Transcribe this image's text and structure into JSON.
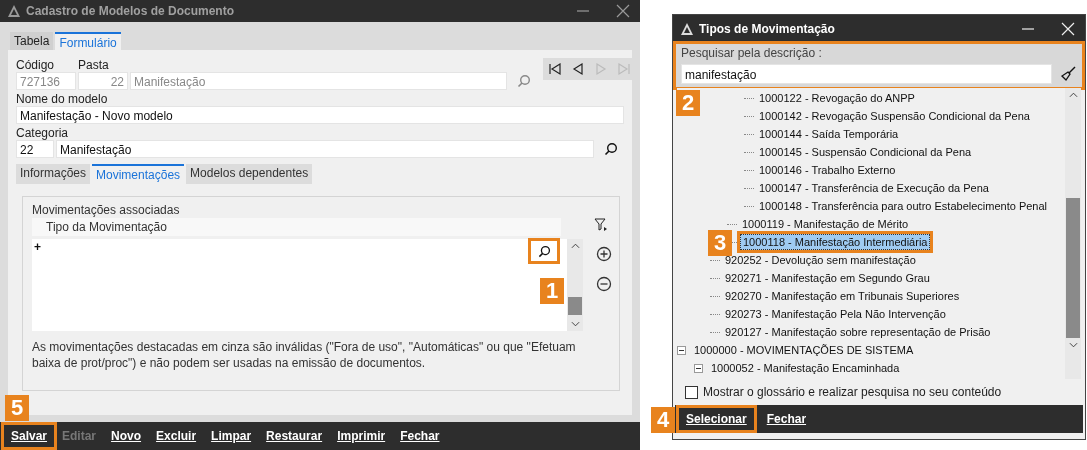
{
  "left_window": {
    "title": "Cadastro de Modelos de Documento",
    "tabs": [
      {
        "label": "Tabela",
        "selected": false
      },
      {
        "label": "Formulário",
        "selected": true
      }
    ],
    "codigo": {
      "label": "Código",
      "value": "727136",
      "disabled": true
    },
    "pasta": {
      "label": "Pasta",
      "number": "22",
      "name": "Manifestação",
      "disabled": true
    },
    "nome": {
      "label": "Nome do modelo",
      "value": "Manifestação - Novo modelo"
    },
    "categoria": {
      "label": "Categoria",
      "number": "22",
      "name": "Manifestação"
    },
    "nav_buttons": [
      {
        "kind": "first",
        "disabled": false
      },
      {
        "kind": "prev",
        "disabled": false
      },
      {
        "kind": "next",
        "disabled": true
      },
      {
        "kind": "last",
        "disabled": true
      }
    ],
    "subtabs": [
      {
        "label": "Informações",
        "selected": false
      },
      {
        "label": "Movimentações",
        "selected": true
      },
      {
        "label": "Modelos dependentes",
        "selected": false
      }
    ],
    "group": {
      "title": "Movimentações associadas",
      "column": "Tipo da Movimentação",
      "row_marker": "+",
      "note": "As movimentações destacadas em cinza são inválidas (\"Fora de uso\", \"Automáticas\" ou que \"Efetuam baixa de prot/proc\") e não podem ser usadas na emissão de documentos."
    },
    "toolbar": [
      {
        "label": "Salvar",
        "disabled": false
      },
      {
        "label": "Editar",
        "disabled": true
      },
      {
        "label": "Novo",
        "disabled": false
      },
      {
        "label": "Excluir",
        "disabled": false
      },
      {
        "label": "Limpar",
        "disabled": false
      },
      {
        "label": "Restaurar",
        "disabled": false
      },
      {
        "label": "Imprimir",
        "disabled": false
      },
      {
        "label": "Fechar",
        "disabled": false
      }
    ]
  },
  "right_window": {
    "title": "Tipos de Movimentação",
    "search": {
      "label": "Pesquisar pela descrição :",
      "value": "manifestação"
    },
    "tree": [
      {
        "children": [
          {
            "children": [
              {
                "children": [
                  {
                    "label": "1000122 - Revogação do ANPP",
                    "selected": false
                  },
                  {
                    "label": "1000142 - Revogação Suspensão Condicional da Pena",
                    "selected": false
                  },
                  {
                    "label": "1000144 - Saída Temporária",
                    "selected": false
                  },
                  {
                    "label": "1000145 - Suspensão Condicional da Pena",
                    "selected": false
                  },
                  {
                    "label": "1000146 - Trabalho Externo",
                    "selected": false
                  },
                  {
                    "label": "1000147 - Transferência de Execução da Pena",
                    "selected": false
                  },
                  {
                    "label": "1000148 - Transferência para outro Estabelecimento Penal",
                    "selected": false
                  }
                ]
              },
              {
                "label": "1000119 - Manifestação de Mérito",
                "selected": false
              },
              {
                "label": "1000118 - Manifestação Intermediária",
                "selected": true
              }
            ]
          },
          {
            "label": "920252 - Devolução sem manifestação",
            "selected": false
          },
          {
            "label": "920271 - Manifestação em Segundo Grau",
            "selected": false
          },
          {
            "label": "920270 - Manifestação  em Tribunais Superiores",
            "selected": false
          },
          {
            "label": "920273 - Manifestação Pela Não Intervenção",
            "selected": false
          },
          {
            "label": "920127 - Manifestação sobre representação de Prisão",
            "selected": false
          }
        ]
      },
      {
        "label": "1000000 - MOVIMENTAÇÕES DE SISTEMA",
        "selected": false,
        "expanded": true,
        "children": [
          {
            "label": "1000052 - Manifestação Encaminhada",
            "selected": false,
            "expanded": true
          }
        ]
      }
    ],
    "glossary": {
      "label": "Mostrar o glossário e realizar pesquisa no seu conteúdo",
      "checked": false
    },
    "buttons": [
      {
        "label": "Selecionar"
      },
      {
        "label": "Fechar"
      }
    ]
  },
  "callouts": [
    "1",
    "2",
    "3",
    "4",
    "5"
  ]
}
